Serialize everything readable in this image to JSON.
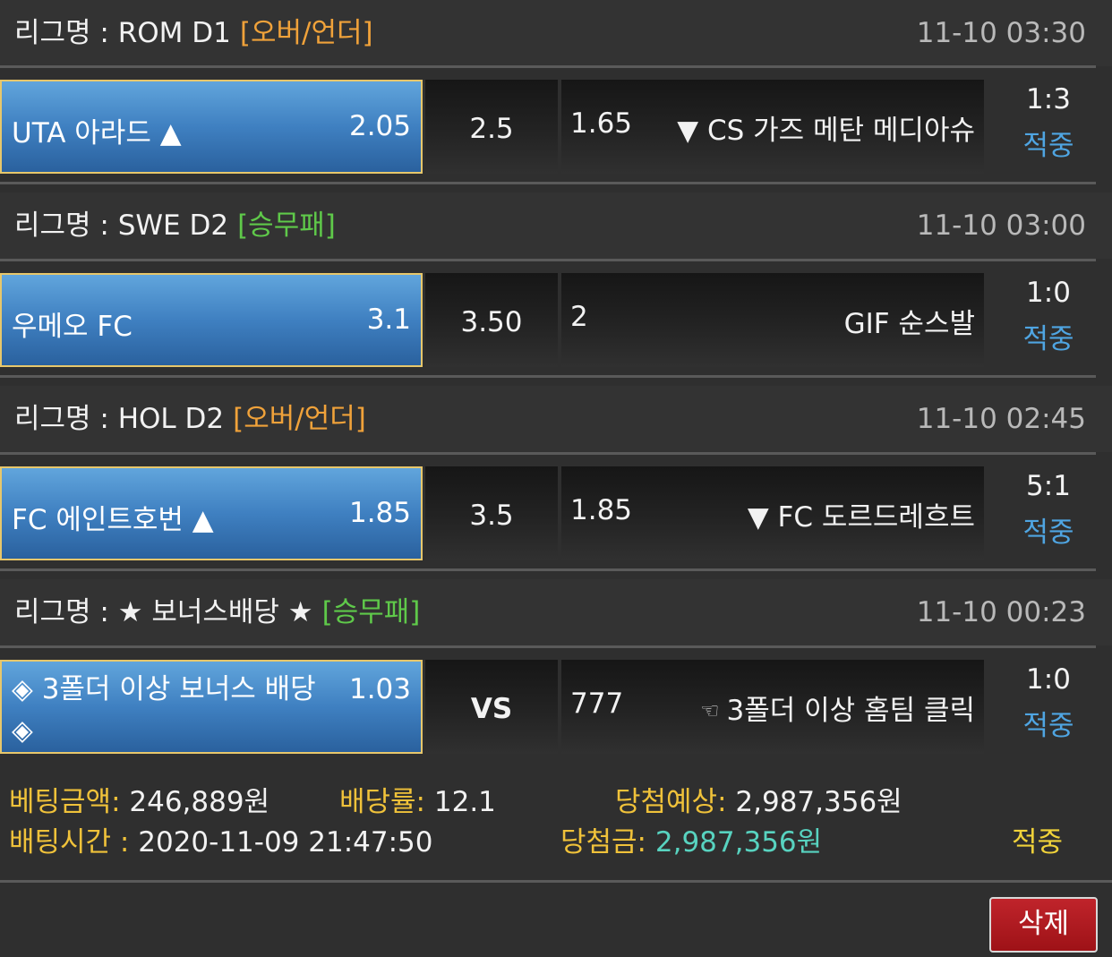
{
  "groups": [
    {
      "league_label": "리그명 : ROM D1",
      "bet_type": "[오버/언더]",
      "bet_type_color": "#f0a23a",
      "time": "11-10 03:30",
      "home_team": "UTA 아라드 ▲",
      "home_odds": "2.05",
      "middle": "2.5",
      "away_odds": "1.65",
      "away_team": "▼ CS 가즈 메탄 메디아슈",
      "score": "1:3",
      "status": "적중"
    },
    {
      "league_label": "리그명 : SWE D2",
      "bet_type": "[승무패]",
      "bet_type_color": "#5fc94a",
      "time": "11-10 03:00",
      "home_team": "우메오 FC",
      "home_odds": "3.1",
      "middle": "3.50",
      "away_odds": "2",
      "away_team": "GIF 순스발",
      "score": "1:0",
      "status": "적중"
    },
    {
      "league_label": "리그명 : HOL D2",
      "bet_type": "[오버/언더]",
      "bet_type_color": "#f0a23a",
      "time": "11-10 02:45",
      "home_team": "FC 에인트호번 ▲",
      "home_odds": "1.85",
      "middle": "3.5",
      "away_odds": "1.85",
      "away_team": "▼ FC 도르드레흐트",
      "score": "5:1",
      "status": "적중"
    },
    {
      "league_label": "리그명 : ★ 보너스배당 ★",
      "bet_type": "[승무패]",
      "bet_type_color": "#5fc94a",
      "time": "11-10 00:23",
      "home_team": "◈ 3폴더 이상 보너스 배당 ◈",
      "home_odds": "1.03",
      "middle": "VS",
      "away_odds": "777",
      "away_team_icon": "☜",
      "away_team": "3폴더 이상 홈팀 클릭",
      "score": "1:0",
      "status": "적중"
    }
  ],
  "summary": {
    "bet_amount_label": "베팅금액:",
    "bet_amount": "246,889원",
    "odds_label": "배당률:",
    "odds": "12.1",
    "expected_label": "당첨예상:",
    "expected": "2,987,356원",
    "bet_time_label": "배팅시간 :",
    "bet_time": "2020-11-09 21:47:50",
    "win_label": "당첨금:",
    "win_amount": "2,987,356원",
    "result": "적중"
  },
  "delete_label": "삭제",
  "colors": {
    "status_blue": "#4fa5e2",
    "label_gold": "#f0c23a",
    "win_teal": "#58d3c0",
    "delete_red": "#b81d23"
  }
}
